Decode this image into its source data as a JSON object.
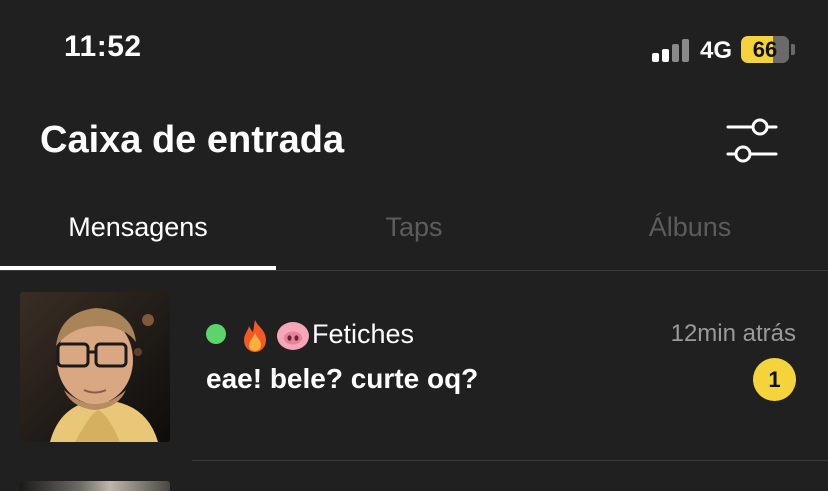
{
  "status_bar": {
    "time": "11:52",
    "network": "4G",
    "battery_level": "66",
    "signal_bars_active": 2,
    "signal_bars_total": 4
  },
  "header": {
    "title": "Caixa de entrada",
    "filter_icon": "sliders-icon"
  },
  "tabs": [
    {
      "label": "Mensagens",
      "active": true
    },
    {
      "label": "Taps",
      "active": false
    },
    {
      "label": "Álbuns",
      "active": false
    }
  ],
  "conversations": [
    {
      "name": "Fetiches",
      "icons": [
        "online-dot",
        "fire-icon",
        "pig-icon"
      ],
      "time": "12min atrás",
      "message": "eae! bele? curte oq?",
      "unread": "1"
    }
  ],
  "colors": {
    "background": "#202020",
    "accent": "#f4d43a",
    "online": "#5bd46a",
    "muted_text": "#9a9a9a",
    "inactive_tab": "#5c5c5c"
  }
}
